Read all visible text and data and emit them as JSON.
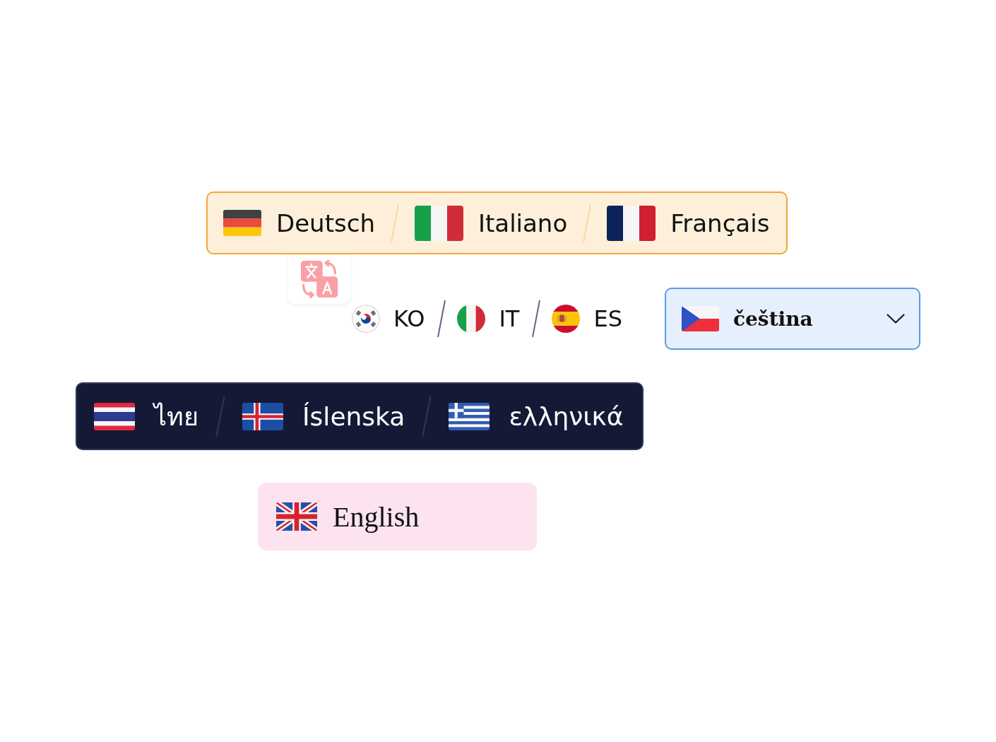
{
  "language_bar": {
    "items": [
      {
        "kind": "germany",
        "label": "Deutsch"
      },
      {
        "kind": "italy",
        "label": "Italiano"
      },
      {
        "kind": "france",
        "label": "Français"
      }
    ]
  },
  "language_codes": {
    "items": [
      {
        "kind": "korea",
        "label": "KO"
      },
      {
        "kind": "italy",
        "label": "IT"
      },
      {
        "kind": "spain",
        "label": "ES"
      }
    ]
  },
  "dropdown": {
    "kind": "czechia",
    "value": "čeština"
  },
  "dark_bar": {
    "items": [
      {
        "kind": "thailand",
        "label": "ไทย"
      },
      {
        "kind": "iceland",
        "label": "Íslenska"
      },
      {
        "kind": "greece",
        "label": "ελληνικά"
      }
    ]
  },
  "language_button": {
    "kind": "uk",
    "label": "English"
  }
}
